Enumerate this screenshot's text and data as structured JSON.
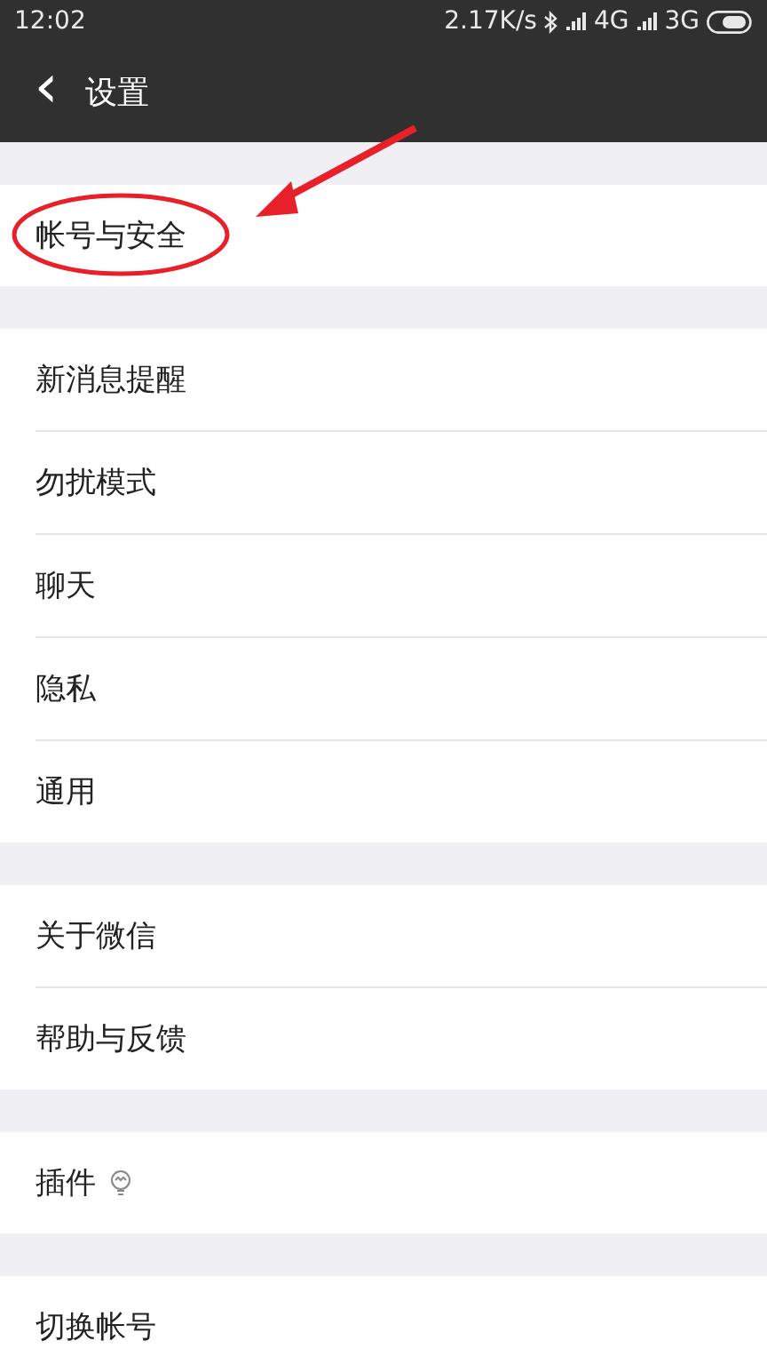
{
  "status_bar": {
    "time": "12:02",
    "speed": "2.17K/s",
    "network_1": "4G",
    "network_2": "3G"
  },
  "header": {
    "back": "‹",
    "title": "设置"
  },
  "groups": [
    {
      "items": [
        {
          "label": "帐号与安全",
          "kind": "text",
          "circled": true
        }
      ]
    },
    {
      "items": [
        {
          "label": "新消息提醒",
          "kind": "text",
          "circled": false
        },
        {
          "label": "勿扰模式",
          "kind": "text",
          "circled": false
        },
        {
          "label": "聊天",
          "kind": "text",
          "circled": false
        },
        {
          "label": "隐私",
          "kind": "text",
          "circled": false
        },
        {
          "label": "通用",
          "kind": "text",
          "circled": false
        }
      ]
    },
    {
      "items": [
        {
          "label": "关于微信",
          "kind": "text",
          "circled": false
        },
        {
          "label": "帮助与反馈",
          "kind": "text",
          "circled": false
        }
      ]
    },
    {
      "items": [
        {
          "label": "插件",
          "kind": "bulb",
          "circled": false
        }
      ]
    },
    {
      "items": [
        {
          "label": "切换帐号",
          "kind": "text",
          "circled": false
        }
      ]
    }
  ]
}
